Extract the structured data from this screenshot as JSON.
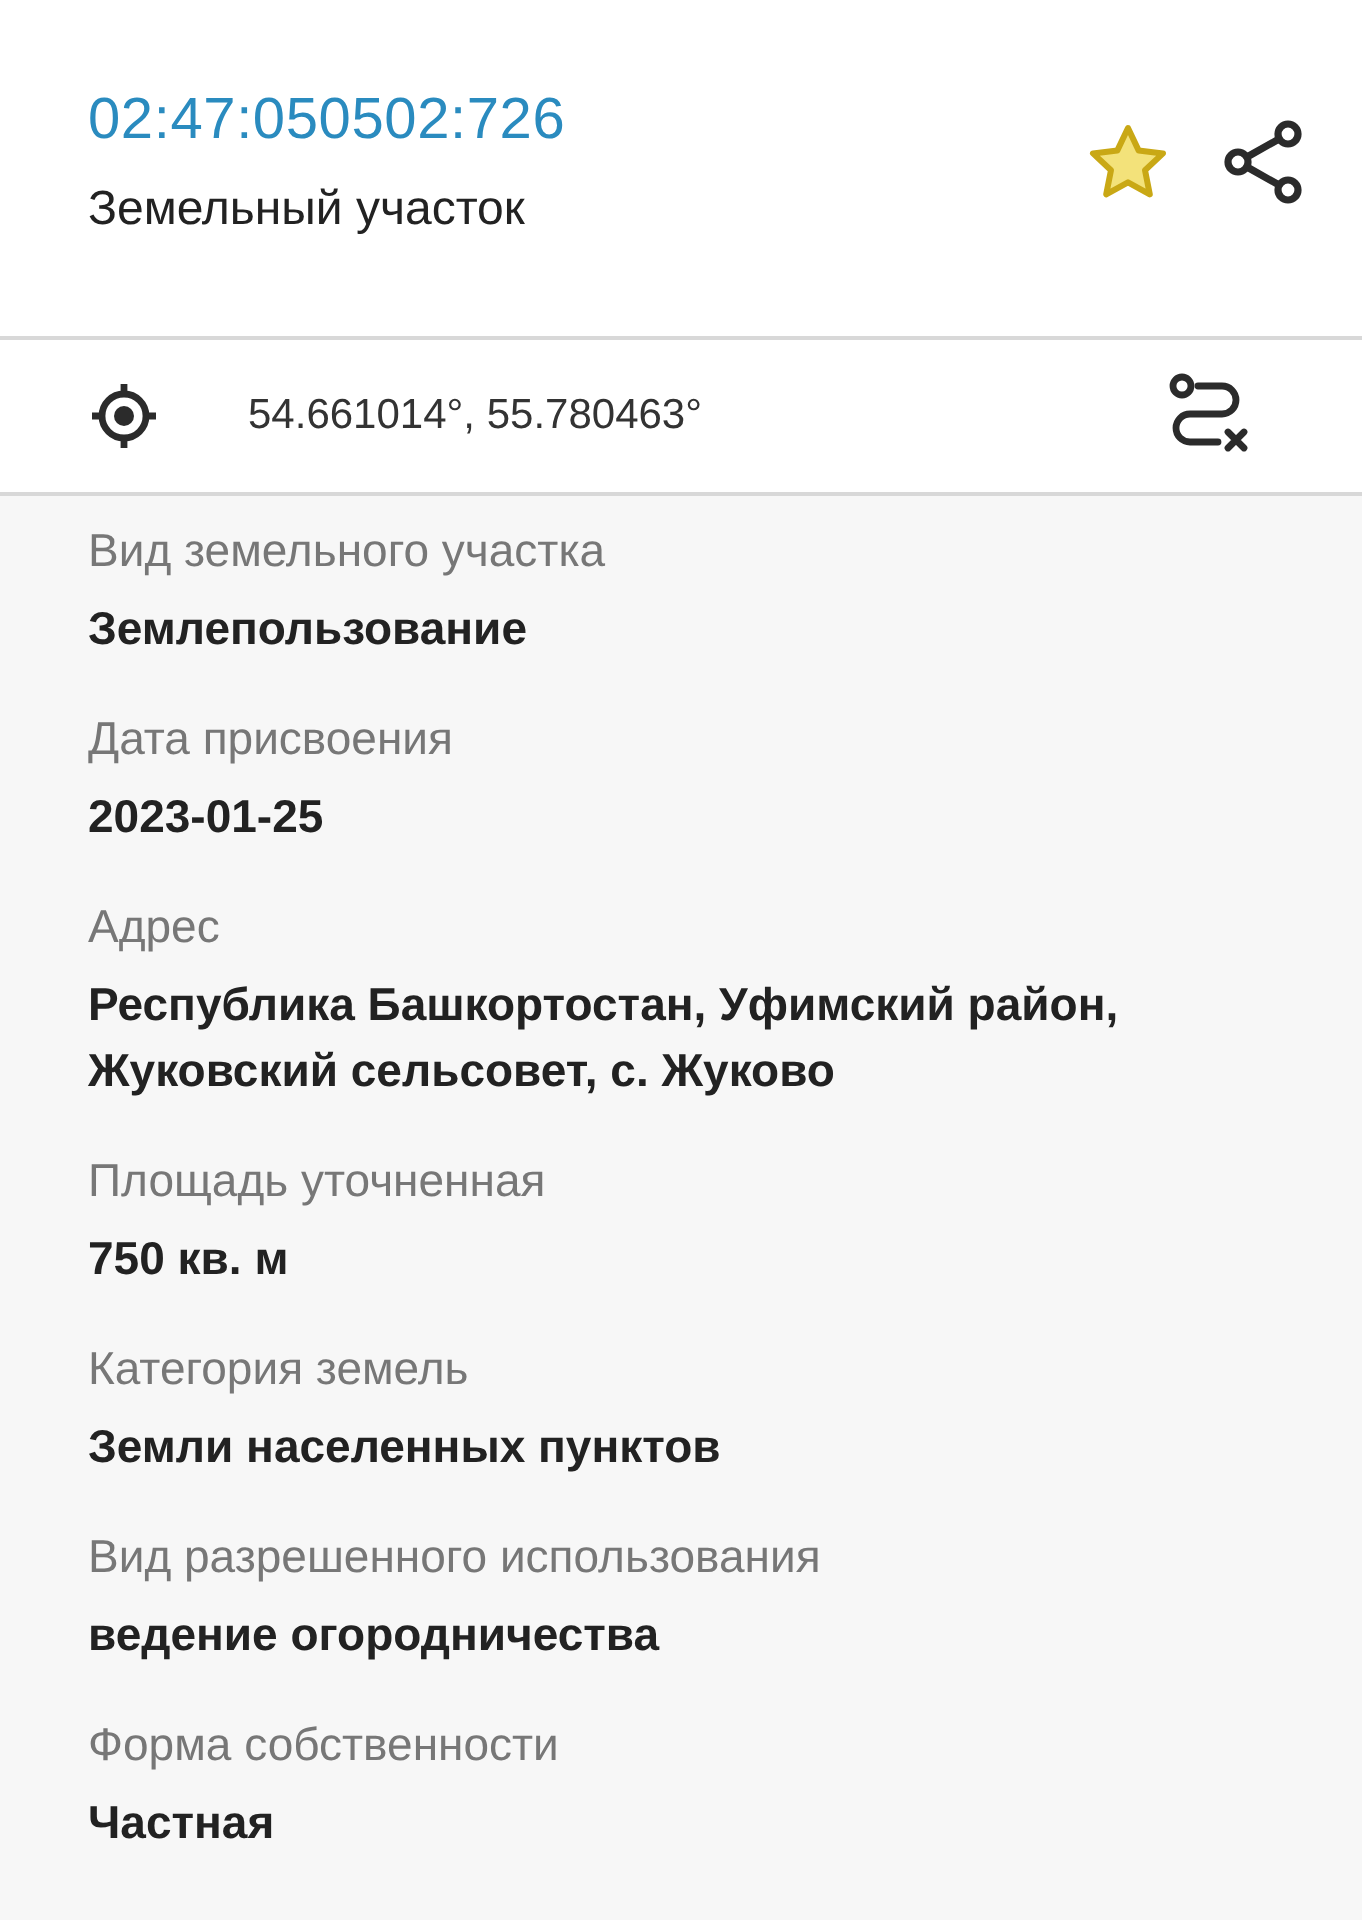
{
  "header": {
    "cadastral_number": "02:47:050502:726",
    "object_type": "Земельный участок",
    "favorite": true
  },
  "coordinates": {
    "text": "54.661014°, 55.780463°"
  },
  "properties": [
    {
      "label": "Вид земельного участка",
      "value": "Землепользование"
    },
    {
      "label": "Дата присвоения",
      "value": "2023-01-25"
    },
    {
      "label": "Адрес",
      "value": "Республика Башкортостан, Уфимский район, Жуковский сельсовет, с. Жуково"
    },
    {
      "label": "Площадь уточненная",
      "value": "750 кв. м"
    },
    {
      "label": "Категория земель",
      "value": "Земли населенных пунктов"
    },
    {
      "label": "Вид разрешенного использования",
      "value": "ведение огородничества"
    },
    {
      "label": "Форма собственности",
      "value": "Частная"
    }
  ]
}
